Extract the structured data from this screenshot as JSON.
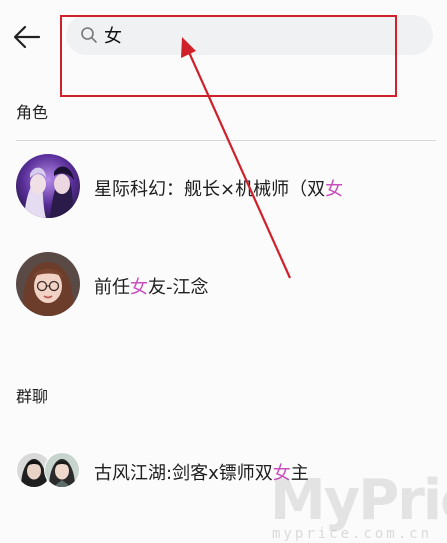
{
  "search": {
    "value": "女",
    "placeholder": ""
  },
  "sections": {
    "characters_title": "角色",
    "groups_title": "群聊"
  },
  "characters": [
    {
      "prefix": "星际科幻：舰长×机械师（双",
      "match": "女",
      "suffix": ""
    },
    {
      "prefix": "前任",
      "match": "女",
      "suffix": "友-江念"
    }
  ],
  "groups": [
    {
      "prefix": "古风江湖:剑客x镖师双",
      "match": "女",
      "suffix": "主"
    }
  ],
  "watermark": {
    "main": "MyPrice",
    "sub": "myprice.com.cn"
  },
  "colors": {
    "highlight": "#c94fbe",
    "annotation": "#d0202a"
  }
}
